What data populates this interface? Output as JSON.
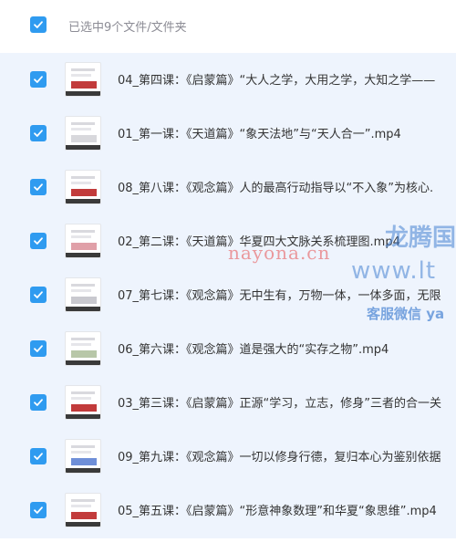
{
  "colors": {
    "accent": "#2f9bf0",
    "list_bg": "#eef4fd",
    "text": "#333333",
    "muted_text": "#8c8c95"
  },
  "header": {
    "select_all_checked": true,
    "selection_label": "已选中9个文件/文件夹"
  },
  "files": [
    {
      "name": "04_第四课：《启蒙篇》“大人之学，大用之学，大知之学——",
      "checked": true
    },
    {
      "name": "01_第一课：《天道篇》“象天法地”与“天人合一”.mp4",
      "checked": true
    },
    {
      "name": "08_第八课：《观念篇》人的最高行动指导以“不入象”为核心.",
      "checked": true
    },
    {
      "name": "02_第二课：《天道篇》华夏四大文脉关系梳理图.mp4",
      "checked": true
    },
    {
      "name": "07_第七课：《观念篇》无中生有，万物一体，一体多面，无限",
      "checked": true
    },
    {
      "name": "06_第六课：《观念篇》道是强大的“实存之物”.mp4",
      "checked": true
    },
    {
      "name": "03_第三课：《启蒙篇》正源“学习，立志，修身”三者的合一关",
      "checked": true
    },
    {
      "name": "09_第九课：《观念篇》一切以修身行德，复归本心为鉴别依据",
      "checked": true
    },
    {
      "name": "05_第五课：《启蒙篇》“形意神象数理”和华夏“象思维”.mp4",
      "checked": true
    }
  ],
  "watermarks": {
    "site_cn": "nayona.cn",
    "brand": "龙腾国",
    "site_url": "www.lt",
    "wechat": "客服微信 ya"
  }
}
